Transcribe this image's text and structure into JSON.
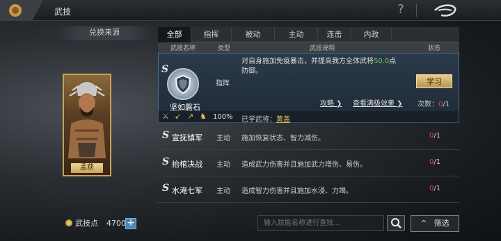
{
  "topbar": {
    "title": "武技",
    "help_icon": "?"
  },
  "left": {
    "source_label": "兑换来源",
    "general_name": "孟获",
    "points_label": "武技点",
    "points_value": "4700",
    "add_label": "+"
  },
  "tabs": [
    {
      "label": "全部",
      "active": true
    },
    {
      "label": "指挥"
    },
    {
      "label": "被动"
    },
    {
      "label": "主动"
    },
    {
      "label": "连击"
    },
    {
      "label": "内政"
    }
  ],
  "header": {
    "name": "武技名称",
    "type": "类型",
    "desc": "武技说明",
    "status": "状态"
  },
  "selected": {
    "grade": "S",
    "name": "坚如磐石",
    "type": "指挥",
    "desc_pre": "对自身施加免疫暴击，并提高我方全体武将",
    "desc_value": "50.0",
    "desc_post": "点防御。",
    "learn_button": "学习",
    "strategy_link": "攻略 ❯",
    "max_effect_link": "查看满级效果 ❯",
    "count_label": "次数：",
    "count_current": "0",
    "count_total": "/1",
    "percent": "100%",
    "learned_label": "已学武将：",
    "learned_name": "黄盖"
  },
  "skills": [
    {
      "grade": "S",
      "name": "宣抚镇军",
      "type": "主动",
      "desc": "施加恢复状态、智力减伤。",
      "cur": "0",
      "total": "/1"
    },
    {
      "grade": "S",
      "name": "抬棺决战",
      "type": "主动",
      "desc": "造成武力伤害并且施加武力增伤、易伤。",
      "cur": "0",
      "total": "/1"
    },
    {
      "grade": "S",
      "name": "水淹七军",
      "type": "主动",
      "desc": "造成智力伤害并且施加水浸、力竭。",
      "cur": "0",
      "total": "/1"
    }
  ],
  "bottom": {
    "search_placeholder": "输入技能名称进行查找...",
    "filter_label": "筛选",
    "filter_icon": "^"
  },
  "colors": {
    "accent_gold": "#c9a25a",
    "highlight_green": "#7ec95a",
    "count_red": "#e04848"
  }
}
